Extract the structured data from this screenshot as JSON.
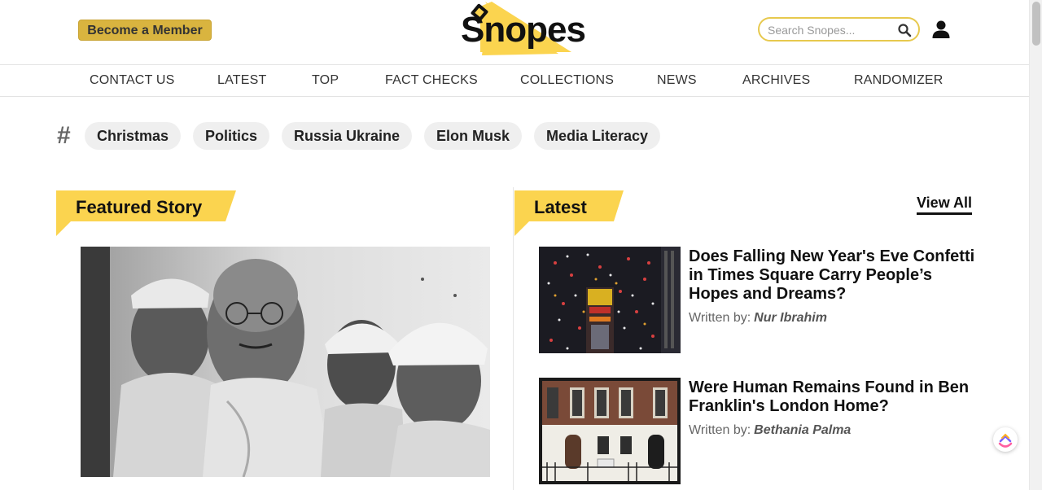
{
  "header": {
    "member_button": "Become a Member",
    "logo_text": "Snopes",
    "search_placeholder": "Search Snopes..."
  },
  "nav": {
    "items": [
      "CONTACT US",
      "LATEST",
      "TOP",
      "FACT CHECKS",
      "COLLECTIONS",
      "NEWS",
      "ARCHIVES",
      "RANDOMIZER"
    ]
  },
  "tags": {
    "hash": "#",
    "items": [
      "Christmas",
      "Politics",
      "Russia Ukraine",
      "Elon Musk",
      "Media Literacy"
    ]
  },
  "featured": {
    "heading": "Featured Story"
  },
  "latest": {
    "heading": "Latest",
    "view_all": "View All",
    "written_by": "Written by:",
    "articles": [
      {
        "title": "Does Falling New Year's Eve Confetti in Times Square Carry People’s Hopes and Dreams?",
        "author": "Nur Ibrahim"
      },
      {
        "title": "Were Human Remains Found in Ben Franklin's London Home?",
        "author": "Bethania Palma"
      }
    ]
  },
  "colors": {
    "accent_yellow": "#fbd44f",
    "member_gold": "#d9b43f",
    "search_border": "#e7c94e"
  }
}
